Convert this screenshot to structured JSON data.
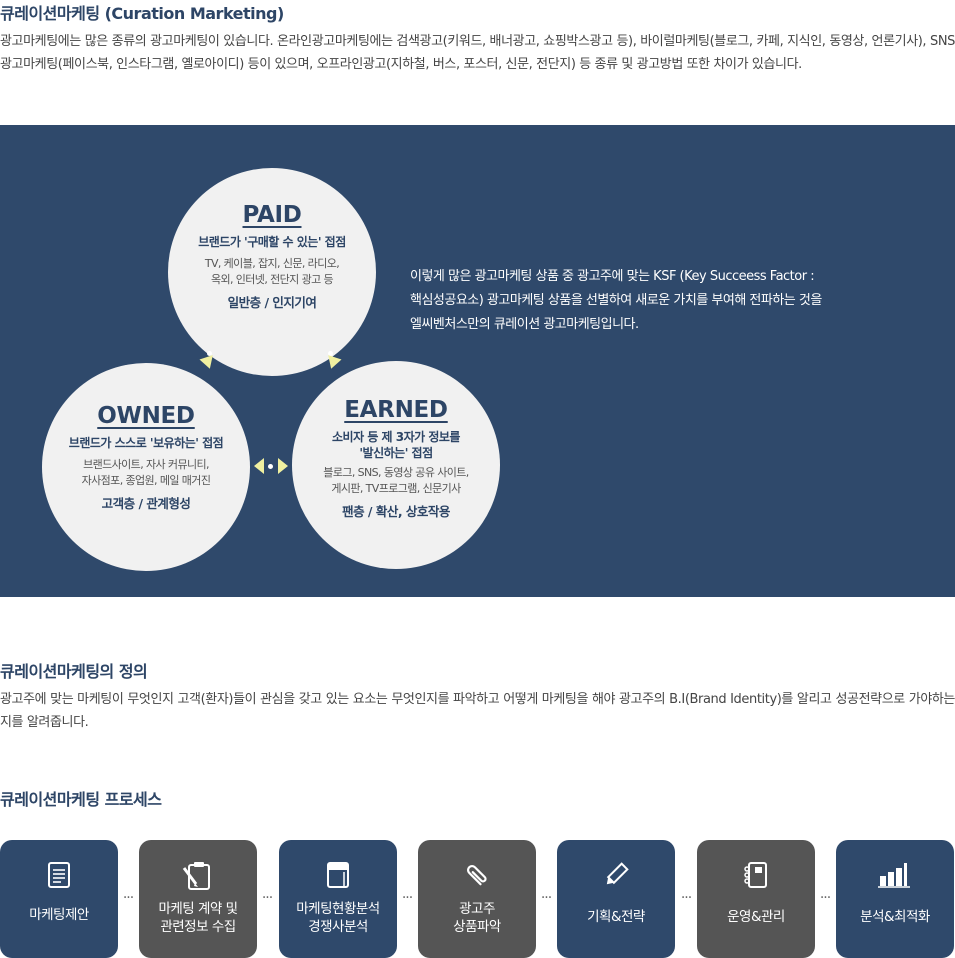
{
  "intro": {
    "title": "큐레이션마케팅 (Curation Marketing)",
    "text": "광고마케팅에는 많은 종류의 광고마케팅이 있습니다. 온라인광고마케팅에는 검색광고(키워드, 배너광고, 쇼핑박스광고 등), 바이럴마케팅(블로그, 카페, 지식인, 동영상, 언론기사), SNS광고마케팅(페이스북, 인스타그램, 옐로아이디) 등이 있으며, 오프라인광고(지하철, 버스, 포스터, 신문, 전단지) 등 종류 및 광고방법 또한 차이가 있습니다."
  },
  "diagram": {
    "paid": {
      "title": "PAID",
      "subtitle": "브랜드가 '구매할 수 있는' 접점",
      "desc_1": "TV, 케이블, 잡지, 신문, 라디오,",
      "desc_2": "옥외, 인터넷, 전단지 광고 등",
      "footer": "일반층 / 인지기여"
    },
    "owned": {
      "title": "OWNED",
      "subtitle": "브랜드가 스스로 '보유하는' 접점",
      "desc_1": "브랜드사이트, 자사 커뮤니티,",
      "desc_2": "자사점포, 종업원, 메일 매거진",
      "footer": "고객층 / 관계형성"
    },
    "earned": {
      "title": "EARNED",
      "subtitle_1": "소비자 등 제 3자가 정보를",
      "subtitle_2": "'발신하는' 접점",
      "desc_1": "블로그, SNS, 동영상 공유 사이트,",
      "desc_2": "게시판, TV프로그램, 신문기사",
      "footer": "팬층 / 확산, 상호작용"
    },
    "description_1": "이렇게 많은 광고마케팅 상품 중 광고주에 맞는 KSF (Key Succeess Factor :",
    "description_2": "핵심성공요소) 광고마케팅 상품을 선별하여 새로운 가치를 부여해 전파하는 것을",
    "description_3": "엘씨벤처스만의 큐레이션 광고마케팅입니다."
  },
  "definition": {
    "title": "큐레이션마케팅의 정의",
    "text": "광고주에 맞는 마케팅이 무엇인지 고객(환자)들이 관심을 갖고 있는 요소는 무엇인지를 파악하고 어떻게 마케팅을 해야 광고주의 B.I(Brand Identity)를 알리고 성공전략으로 가야하는지를 알려줍니다."
  },
  "process": {
    "title": "큐레이션마케팅 프로세스",
    "separator": "···",
    "steps": [
      {
        "line1": "마케팅제안",
        "line2": "",
        "icon": "document-icon",
        "color": "#2f496b"
      },
      {
        "line1": "마케팅 계약 및",
        "line2": "관련정보 수집",
        "icon": "clipboard-pen-icon",
        "color": "#555555"
      },
      {
        "line1": "마케팅현황분석",
        "line2": "경쟁사분석",
        "icon": "notebook-icon",
        "color": "#2f496b"
      },
      {
        "line1": "광고주",
        "line2": "상품파악",
        "icon": "paperclip-icon",
        "color": "#555555"
      },
      {
        "line1": "기획&전략",
        "line2": "",
        "icon": "pencil-icon",
        "color": "#2f496b"
      },
      {
        "line1": "운영&관리",
        "line2": "",
        "icon": "binder-icon",
        "color": "#555555"
      },
      {
        "line1": "분석&최적화",
        "line2": "",
        "icon": "bar-chart-icon",
        "color": "#2f496b"
      }
    ]
  }
}
